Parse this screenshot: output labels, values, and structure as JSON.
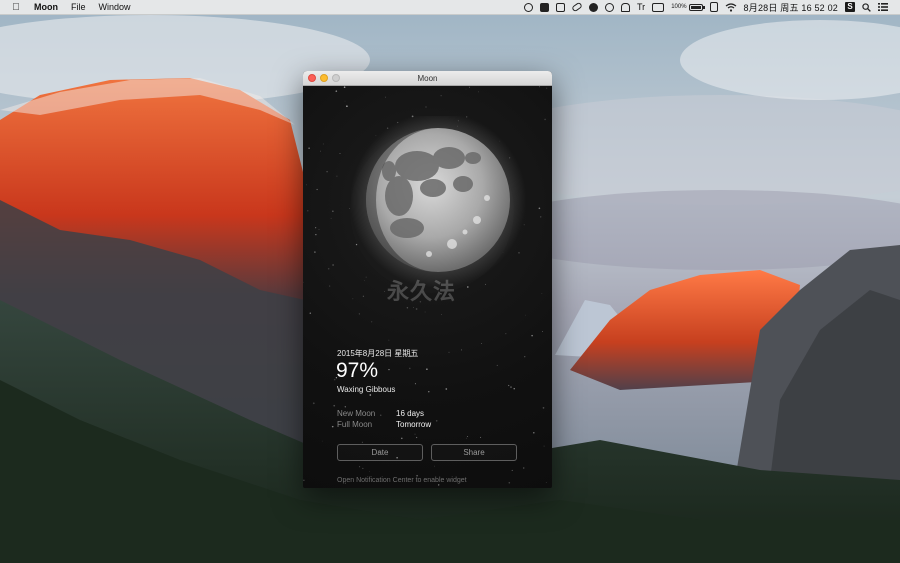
{
  "menubar": {
    "apple_icon": "apple-icon",
    "app_name": "Moon",
    "menus": [
      "File",
      "Window"
    ],
    "status_text_tr": "Tr",
    "battery_percent": "100%",
    "clock": "8月28日 周五  16 52 02",
    "s_badge": "S"
  },
  "window": {
    "title": "Moon",
    "watermark": "永久法"
  },
  "moon": {
    "illumination_fraction": 0.97
  },
  "info": {
    "date": "2015年8月28日 星期五",
    "percent": "97%",
    "phase": "Waxing Gibbous",
    "rows": [
      {
        "label": "New Moon",
        "value": "16 days"
      },
      {
        "label": "Full Moon",
        "value": "Tomorrow"
      }
    ]
  },
  "buttons": {
    "date": "Date",
    "share": "Share"
  },
  "footer": "Open Notification Center to enable widget"
}
